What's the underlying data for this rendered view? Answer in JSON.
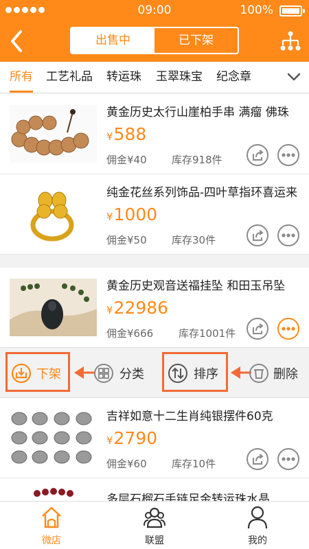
{
  "status_bar": {
    "time": "09:00",
    "battery": "100%"
  },
  "header": {
    "segments": [
      {
        "label": "出售中",
        "active": true
      },
      {
        "label": "已下架",
        "active": false
      }
    ]
  },
  "tabs": [
    {
      "label": "所有",
      "active": true
    },
    {
      "label": "工艺礼品",
      "active": false
    },
    {
      "label": "转运珠",
      "active": false
    },
    {
      "label": "玉翠珠宝",
      "active": false
    },
    {
      "label": "纪念章",
      "active": false
    }
  ],
  "currency_symbol": "¥",
  "products": [
    {
      "title": "黄金历史太行山崖柏手串 满瘤 佛珠",
      "price": "588",
      "commission": "佣金¥40",
      "stock": "库存918件",
      "image": "wooden-bead-bracelet"
    },
    {
      "title": "纯金花丝系列饰品-四叶草指环喜运来",
      "price": "1000",
      "commission": "佣金¥50",
      "stock": "库存30件",
      "image": "gold-clover-ring"
    },
    {
      "title": "黄金历史观音送福挂坠 和田玉吊坠",
      "price": "22986",
      "commission": "佣金¥666",
      "stock": "库存1001件",
      "image": "jade-guanyin-pendant"
    },
    {
      "title": "吉祥如意十二生肖纯银摆件60克",
      "price": "2790",
      "commission": "佣金¥60",
      "stock": "库存10件",
      "image": "silver-zodiac-figurines"
    },
    {
      "title": "多层石榴石手链足金转运珠水晶",
      "image": "garnet-bracelet"
    }
  ],
  "action_bar": {
    "unlist": "下架",
    "category": "分类",
    "sort": "排序",
    "delete": "删除"
  },
  "bottom_nav": [
    {
      "label": "微店",
      "icon": "shop-icon",
      "active": true
    },
    {
      "label": "联盟",
      "icon": "group-icon",
      "active": false
    },
    {
      "label": "我的",
      "icon": "profile-icon",
      "active": false
    }
  ],
  "colors": {
    "accent": "#ff8a1a",
    "highlight": "#f26a36"
  }
}
